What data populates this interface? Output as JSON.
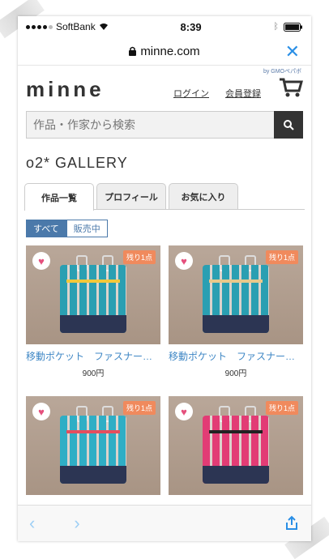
{
  "status": {
    "carrier": "SoftBank",
    "time": "8:39"
  },
  "browser": {
    "url": "minne.com"
  },
  "header": {
    "logo": "minne",
    "partner": "by GMOペパボ",
    "login": "ログイン",
    "register": "会員登録"
  },
  "search": {
    "placeholder": "作品・作家から検索"
  },
  "gallery": {
    "title": "o2* GALLERY"
  },
  "tabs": [
    {
      "label": "作品一覧"
    },
    {
      "label": "プロフィール"
    },
    {
      "label": "お気に入り"
    }
  ],
  "filters": [
    {
      "label": "すべて"
    },
    {
      "label": "販売中"
    }
  ],
  "products": [
    {
      "name": "移動ポケット　ファスナー付き",
      "price": "900円",
      "badge": "残り1点",
      "color": "#2a9fb2",
      "zip": "#f2c83a"
    },
    {
      "name": "移動ポケット　ファスナー付き",
      "price": "900円",
      "badge": "残り1点",
      "color": "#2a9fb2",
      "zip": "#e9c98a"
    },
    {
      "name": "",
      "price": "",
      "badge": "残り1点",
      "color": "#2faec5",
      "zip": "#e44e5e"
    },
    {
      "name": "",
      "price": "",
      "badge": "残り1点",
      "color": "#e23c75",
      "zip": "#222"
    }
  ]
}
